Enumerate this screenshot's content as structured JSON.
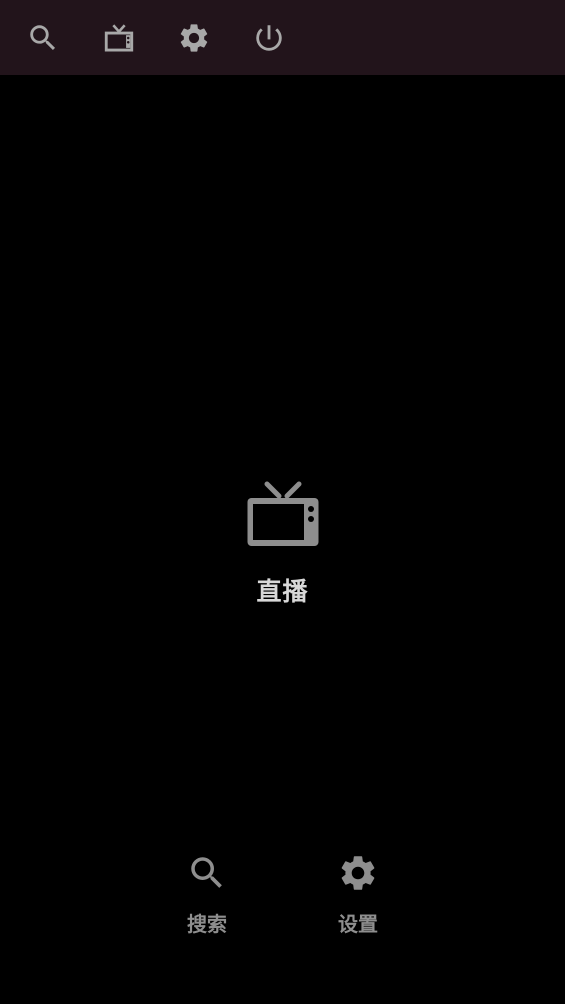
{
  "top_bar": {
    "items": [
      {
        "icon": "search-icon"
      },
      {
        "icon": "tv-icon"
      },
      {
        "icon": "settings-icon"
      },
      {
        "icon": "power-icon"
      }
    ],
    "background": "#22141b",
    "icon_color": "#a8a8a8"
  },
  "main": {
    "live": {
      "label": "直播",
      "icon": "tv-icon"
    }
  },
  "bottom_nav": {
    "search": {
      "label": "搜索",
      "icon": "search-icon"
    },
    "settings": {
      "label": "设置",
      "icon": "settings-icon"
    }
  },
  "colors": {
    "background": "#000000",
    "icon_gray": "#8e8e8e",
    "label_light": "#d8d8d8"
  }
}
